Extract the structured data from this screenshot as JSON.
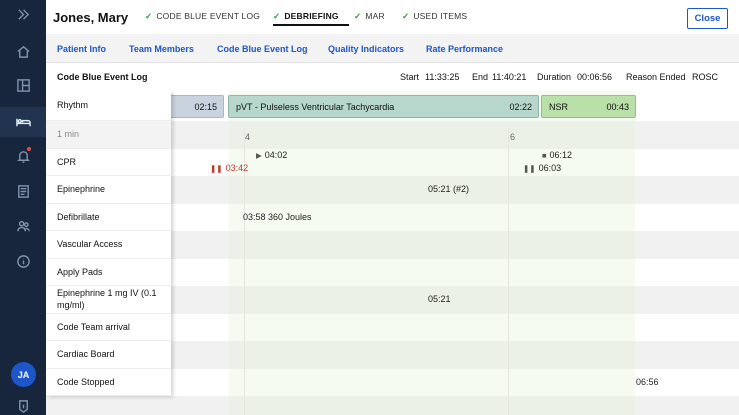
{
  "rail": {
    "avatar_initials": "JA",
    "icons": [
      "collapse-icon",
      "home-icon",
      "layout-icon",
      "bed-icon",
      "bell-icon",
      "document-icon",
      "users-icon",
      "info-icon",
      "logout-icon"
    ]
  },
  "header": {
    "patient_name": "Jones, Mary",
    "steps": [
      {
        "label": "CODE BLUE EVENT LOG",
        "done": true
      },
      {
        "label": "DEBRIEFING",
        "done": true,
        "active": true
      },
      {
        "label": "MAR",
        "done": true
      },
      {
        "label": "USED ITEMS",
        "done": true
      }
    ],
    "close_label": "Close"
  },
  "subtabs": [
    "Patient Info",
    "Team Members",
    "Code Blue Event Log",
    "Quality Indicators",
    "Rate Performance"
  ],
  "log": {
    "title": "Code Blue Event Log",
    "start_label": "Start",
    "start_value": "11:33:25",
    "end_label": "End",
    "end_value": "11:40:21",
    "duration_label": "Duration",
    "duration_value": "00:06:56",
    "reason_label": "Reason Ended",
    "reason_value": "ROSC"
  },
  "rows": [
    "Rhythm",
    "1 min",
    "CPR",
    "Epinephrine",
    "Defibrillate",
    "Vascular Access",
    "Apply Pads",
    "Epinephrine 1 mg IV (0.1 mg/ml)",
    "Code Team arrival",
    "Cardiac Board",
    "Code Stopped"
  ],
  "timeline": {
    "ticks": [
      "4",
      "6"
    ],
    "rhythm": [
      {
        "label": "",
        "duration": "02:15"
      },
      {
        "label": "pVT - Pulseless Ventricular Tachycardia",
        "duration": "02:22"
      },
      {
        "label": "NSR",
        "duration": "00:43"
      }
    ],
    "cpr": {
      "pause1": "03:42",
      "play": "04:02",
      "pause2": "06:03",
      "stop": "06:12"
    },
    "epinephrine": "05:21 (#2)",
    "defibrillate": "03:58 360 Joules",
    "epinephrine_iv": "05:21",
    "code_stopped": "06:56"
  }
}
